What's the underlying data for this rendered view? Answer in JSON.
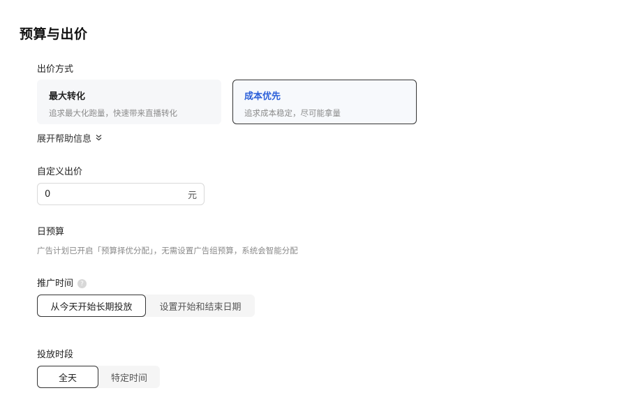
{
  "section": {
    "title": "预算与出价"
  },
  "bid_method": {
    "label": "出价方式",
    "options": [
      {
        "title": "最大转化",
        "desc": "追求最大化跑量，快速带来直播转化",
        "selected": false
      },
      {
        "title": "成本优先",
        "desc": "追求成本稳定，尽可能拿量",
        "selected": true
      }
    ],
    "help_label": "展开帮助信息",
    "help_icon": "chevron-double-down-icon"
  },
  "custom_bid": {
    "label": "自定义出价",
    "value": "0",
    "unit": "元"
  },
  "daily_budget": {
    "label": "日预算",
    "hint": "广告计划已开启「预算择优分配」，无需设置广告组预算，系统会智能分配"
  },
  "promo_time": {
    "label": "推广时间",
    "info_icon": "question-circle-icon",
    "options": [
      {
        "label": "从今天开始长期投放",
        "active": true
      },
      {
        "label": "设置开始和结束日期",
        "active": false
      }
    ]
  },
  "schedule": {
    "label": "投放时段",
    "options": [
      {
        "label": "全天",
        "active": true
      },
      {
        "label": "特定时间",
        "active": false
      }
    ]
  },
  "colors": {
    "accent": "#2b5fd9",
    "selected_border": "#333333",
    "muted_text": "#8a8a8a"
  }
}
